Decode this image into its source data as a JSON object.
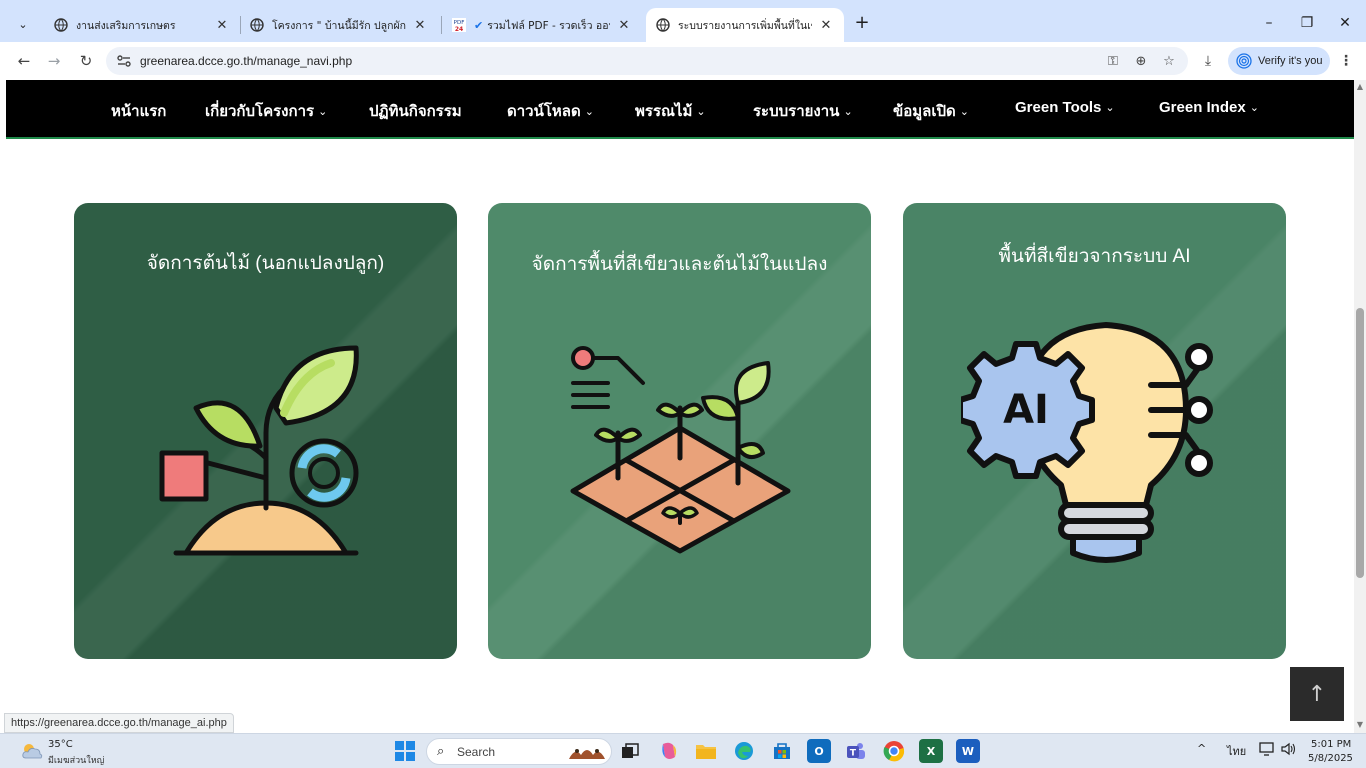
{
  "browser": {
    "tabs": [
      {
        "title": "งานส่งเสริมการเกษตร",
        "active": false
      },
      {
        "title": "โครงการ \" บ้านนี้มีรัก ปลูกผักกินเอง",
        "active": false
      },
      {
        "title": "รวมไฟล์ PDF - รวดเร็ว ออนไลน์ ฟรี",
        "active": false
      },
      {
        "title": "ระบบรายงานการเพิ่มพื้นที่ในเขตชุมชน",
        "active": true
      }
    ],
    "new_tab_symbol": "+",
    "url": "greenarea.dcce.go.th/manage_navi.php",
    "verify_label": "Verify it's you",
    "status_url": "https://greenarea.dcce.go.th/manage_ai.php",
    "pdf_badge": "PDF 24"
  },
  "site_nav": {
    "items": [
      {
        "label": "หน้าแรก",
        "dropdown": ""
      },
      {
        "label": "เกี่ยวกับโครงการ",
        "dropdown": "⌄"
      },
      {
        "label": "ปฏิทินกิจกรรม",
        "dropdown": ""
      },
      {
        "label": "ดาวน์โหลด",
        "dropdown": "⌄"
      },
      {
        "label": "พรรณไม้",
        "dropdown": "⌄"
      },
      {
        "label": "ระบบรายงาน",
        "dropdown": "⌄"
      },
      {
        "label": "ข้อมูลเปิด",
        "dropdown": "⌄"
      },
      {
        "label": "Green Tools",
        "dropdown": "⌄"
      },
      {
        "label": "Green Index",
        "dropdown": "⌄"
      }
    ]
  },
  "cards": [
    {
      "title": "จัดการต้นไม้ (นอกแปลงปลูก)",
      "icon": "plant-sprout-icon",
      "bg": "#2f5e45"
    },
    {
      "title": "จัดการพื้นที่สีเขียวและต้นไม้ในแปลง",
      "icon": "plot-planting-icon",
      "bg": "#4f8a6a"
    },
    {
      "title": "พื้นที่สีเขียวจากระบบ AI",
      "icon": "ai-lightbulb-icon",
      "bg": "#4a8466"
    }
  ],
  "ai_icon_text": "AI",
  "back_to_top_symbol": "↑",
  "taskbar": {
    "weather_temp": "35°C",
    "weather_desc": "มีเมฆส่วนใหญ่",
    "search_label": "Search",
    "language": "ไทย",
    "time": "5:01 PM",
    "date": "5/8/2025",
    "outlook_letter": "O",
    "excel_letter": "X",
    "word_letter": "W"
  }
}
